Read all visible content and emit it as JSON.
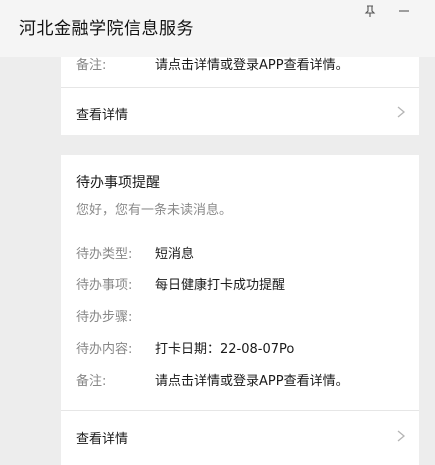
{
  "window": {
    "title": "河北金融学院信息服务",
    "controls": {
      "pin_icon": "pin-icon",
      "minimize_icon": "minimize-icon"
    }
  },
  "prev_card": {
    "remark_label": "备注:",
    "remark_value": "请点击详情或登录APP查看详情。",
    "detail_link": "查看详情"
  },
  "notice_card": {
    "title": "待办事项提醒",
    "subtitle": "您好，您有一条未读消息。",
    "fields": [
      {
        "label": "待办类型:",
        "value": "短消息"
      },
      {
        "label": "待办事项:",
        "value": "每日健康打卡成功提醒"
      },
      {
        "label": "待办步骤:",
        "value": ""
      },
      {
        "label": "待办内容:",
        "value": "打卡日期：22-08-07Po"
      },
      {
        "label": "备注:",
        "value": "请点击详情或登录APP查看详情。"
      }
    ],
    "detail_link": "查看详情"
  }
}
